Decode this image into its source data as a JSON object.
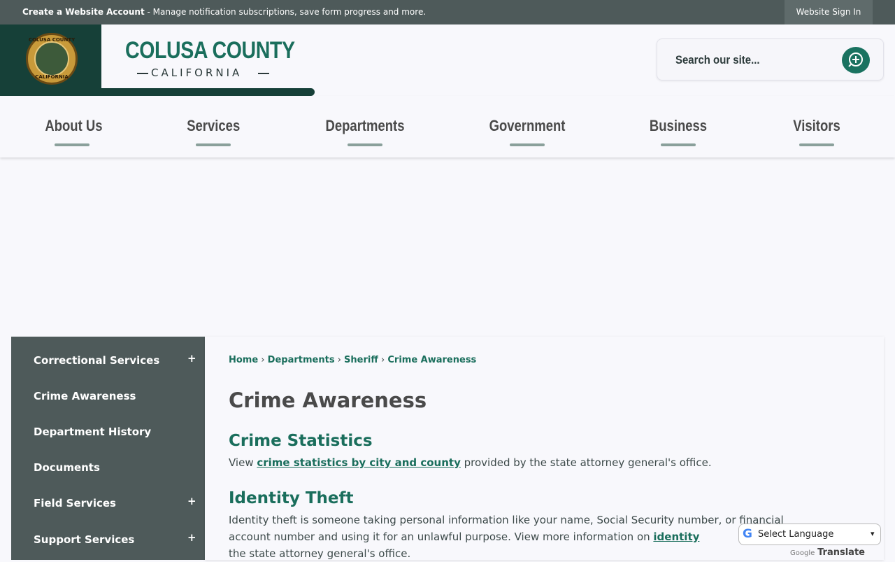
{
  "topbar": {
    "account_link": "Create a Website Account",
    "account_desc": " - Manage notification subscriptions, save form progress and more.",
    "signin": "Website Sign In"
  },
  "header": {
    "seal_top": "COLUSA COUNTY",
    "seal_bottom": "CALIFORNIA",
    "county": "COLUSA COUNTY",
    "state": "CALIFORNIA",
    "search_placeholder": "Search our site..."
  },
  "nav": {
    "items": [
      {
        "label": "About Us"
      },
      {
        "label": "Services"
      },
      {
        "label": "Departments"
      },
      {
        "label": "Government"
      },
      {
        "label": "Business"
      },
      {
        "label": "Visitors"
      }
    ]
  },
  "sidebar": {
    "items": [
      {
        "label": "Correctional Services",
        "expand": "+"
      },
      {
        "label": "Crime Awareness"
      },
      {
        "label": "Department History"
      },
      {
        "label": "Documents"
      },
      {
        "label": "Field Services",
        "expand": "+"
      },
      {
        "label": "Support Services",
        "expand": "+"
      }
    ]
  },
  "breadcrumb": {
    "items": [
      "Home",
      "Departments",
      "Sheriff"
    ],
    "current": "Crime Awareness",
    "sep": "›"
  },
  "main": {
    "title": "Crime Awareness",
    "sections": [
      {
        "heading": "Crime Statistics",
        "lines": [
          {
            "pre": "View ",
            "link": "crime statistics by city and county",
            "post": " provided by the state attorney general's office."
          }
        ]
      },
      {
        "heading": "Identity Theft",
        "lines": [
          {
            "pre": "Identity theft is someone taking personal information like your name, Social Security number, or financial"
          },
          {
            "pre": "account number and using it for an unlawful purpose. View more information on ",
            "link": "identity"
          },
          {
            "pre": "the state attorney general's office."
          }
        ]
      }
    ]
  },
  "translate": {
    "g_letter": "G",
    "label": "Select Language",
    "caret": "▾",
    "powered": "Google",
    "translate": "Translate"
  },
  "colors": {
    "brand_green": "#1a6e5c",
    "dark_green": "#164038",
    "slate": "#4e5a5a"
  }
}
